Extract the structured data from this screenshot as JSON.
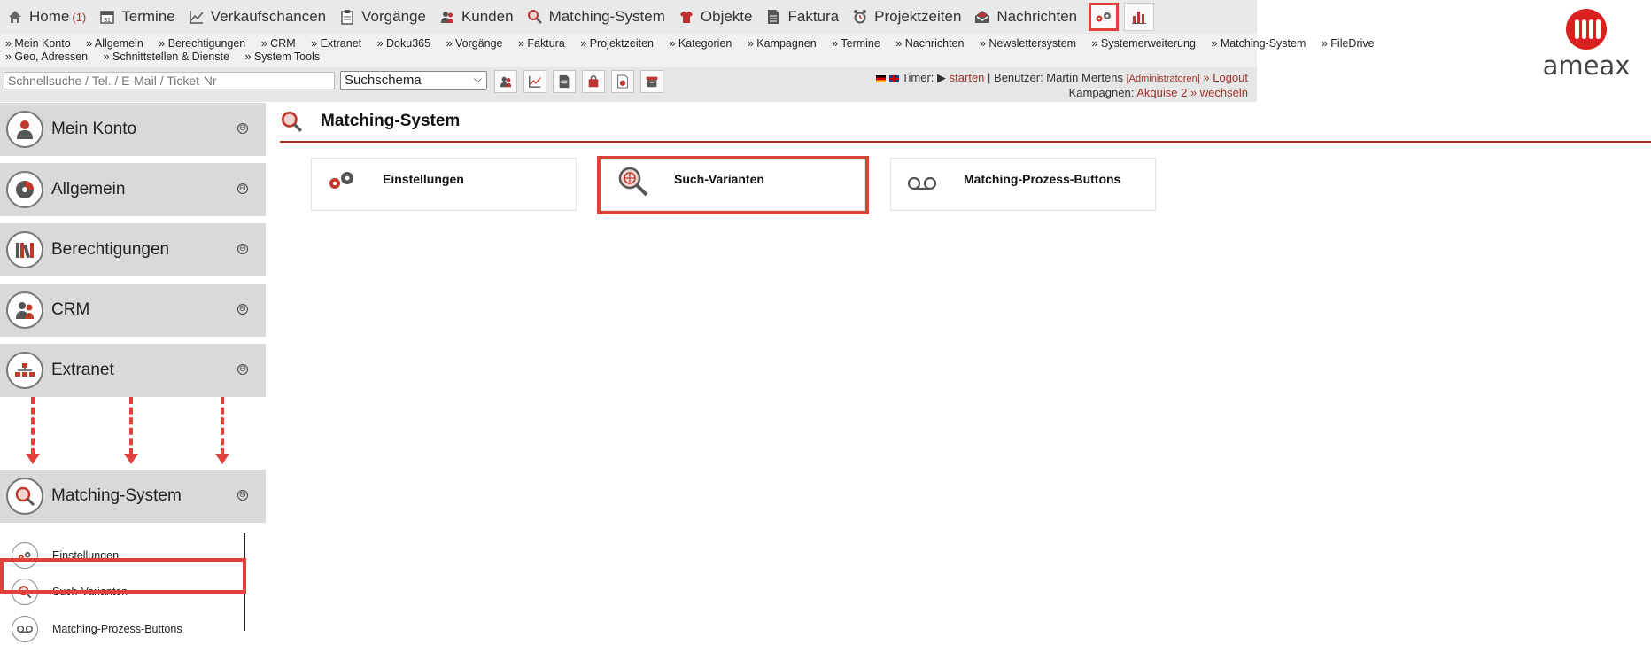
{
  "topnav": {
    "items": [
      {
        "label": "Home",
        "count": "(1)",
        "icon": "home-icon"
      },
      {
        "label": "Termine",
        "icon": "calendar-icon"
      },
      {
        "label": "Verkaufschancen",
        "icon": "chart-line-icon"
      },
      {
        "label": "Vorgänge",
        "icon": "clipboard-icon"
      },
      {
        "label": "Kunden",
        "icon": "users-icon"
      },
      {
        "label": "Matching-System",
        "icon": "magnifier-icon"
      },
      {
        "label": "Objekte",
        "icon": "shirt-icon"
      },
      {
        "label": "Faktura",
        "icon": "document-icon"
      },
      {
        "label": "Projektzeiten",
        "icon": "clock-icon"
      },
      {
        "label": "Nachrichten",
        "icon": "envelope-icon"
      }
    ],
    "icon_buttons": [
      "gears-icon",
      "bar-chart-icon"
    ]
  },
  "subnav": {
    "row1": [
      "» Mein Konto",
      "» Allgemein",
      "» Berechtigungen",
      "» CRM",
      "» Extranet",
      "» Doku365",
      "» Vorgänge",
      "» Faktura",
      "» Projektzeiten",
      "» Kategorien",
      "» Kampagnen",
      "» Termine",
      "» Nachrichten",
      "» Newslettersystem",
      "» Systemerweiterung",
      "» Matching-System",
      "» FileDrive"
    ],
    "row2": [
      "» Geo, Adressen",
      "» Schnittstellen & Dienste",
      "» System Tools"
    ]
  },
  "toolbar": {
    "search_placeholder": "Schnellsuche / Tel. / E-Mail / Ticket-Nr",
    "schema_value": "Suchschema",
    "timer_label": "Timer:",
    "timer_action": "starten",
    "user_prefix": "| Benutzer: Martin Mertens",
    "user_role": "[Administratoren]",
    "logout": "» Logout",
    "campaign_prefix": "Kampagnen:",
    "campaign_value": "Akquise 2",
    "campaign_switch": "» wechseln"
  },
  "logo": {
    "text": "ameax"
  },
  "sidebar": {
    "items": [
      {
        "label": "Mein Konto",
        "icon": "user-icon"
      },
      {
        "label": "Allgemein",
        "icon": "disc-icon"
      },
      {
        "label": "Berechtigungen",
        "icon": "books-icon"
      },
      {
        "label": "CRM",
        "icon": "users-icon"
      },
      {
        "label": "Extranet",
        "icon": "sitemap-icon"
      },
      {
        "label": "Matching-System",
        "icon": "magnifier-icon"
      }
    ],
    "toggle_symbol": "⊖",
    "subitems": [
      {
        "label": "Einstellungen",
        "icon": "gears-icon"
      },
      {
        "label": "Such-Varianten",
        "icon": "magnifier-icon"
      },
      {
        "label": "Matching-Prozess-Buttons",
        "icon": "voicemail-icon"
      }
    ]
  },
  "main": {
    "title": "Matching-System",
    "cards": [
      {
        "label": "Einstellungen",
        "icon": "gears-icon"
      },
      {
        "label": "Such-Varianten",
        "icon": "globe-search-icon"
      },
      {
        "label": "Matching-Prozess-Buttons",
        "icon": "voicemail-icon"
      }
    ]
  },
  "colors": {
    "accent": "#a72b22",
    "highlight": "#e0413a",
    "nav_bg": "#e9e9e9",
    "sidebar_bg": "#d9d9d9"
  }
}
